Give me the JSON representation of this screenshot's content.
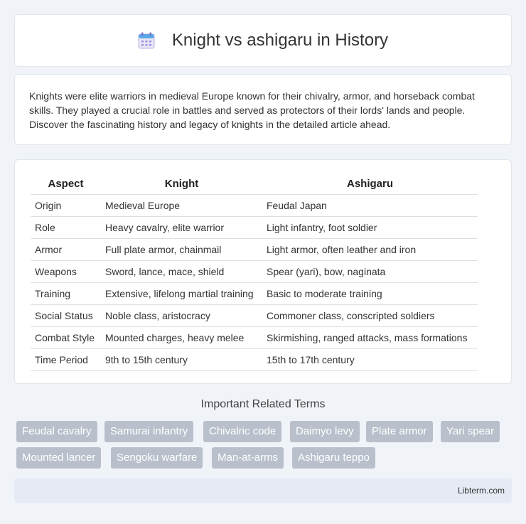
{
  "header": {
    "title": "Knight vs ashigaru in History",
    "icon": "calendar-icon"
  },
  "intro": {
    "text": "Knights were elite warriors in medieval Europe known for their chivalry, armor, and horseback combat skills. They played a crucial role in battles and served as protectors of their lords' lands and people. Discover the fascinating history and legacy of knights in the detailed article ahead."
  },
  "table": {
    "headers": [
      "Aspect",
      "Knight",
      "Ashigaru"
    ],
    "rows": [
      [
        "Origin",
        "Medieval Europe",
        "Feudal Japan"
      ],
      [
        "Role",
        "Heavy cavalry, elite warrior",
        "Light infantry, foot soldier"
      ],
      [
        "Armor",
        "Full plate armor, chainmail",
        "Light armor, often leather and iron"
      ],
      [
        "Weapons",
        "Sword, lance, mace, shield",
        "Spear (yari), bow, naginata"
      ],
      [
        "Training",
        "Extensive, lifelong martial training",
        "Basic to moderate training"
      ],
      [
        "Social Status",
        "Noble class, aristocracy",
        "Commoner class, conscripted soldiers"
      ],
      [
        "Combat Style",
        "Mounted charges, heavy melee",
        "Skirmishing, ranged attacks, mass formations"
      ],
      [
        "Time Period",
        "9th to 15th century",
        "15th to 17th century"
      ]
    ]
  },
  "related": {
    "title": "Important Related Terms",
    "tags": [
      "Feudal cavalry",
      "Samurai infantry",
      "Chivalric code",
      "Daimyo levy",
      "Plate armor",
      "Yari spear",
      "Mounted lancer",
      "Sengoku warfare",
      "Man-at-arms",
      "Ashigaru teppo"
    ]
  },
  "footer": {
    "text": "Libterm.com"
  },
  "colors": {
    "background": "#f0f3f8",
    "tag": "#b9c0cc",
    "footer": "#e6eaf4"
  }
}
